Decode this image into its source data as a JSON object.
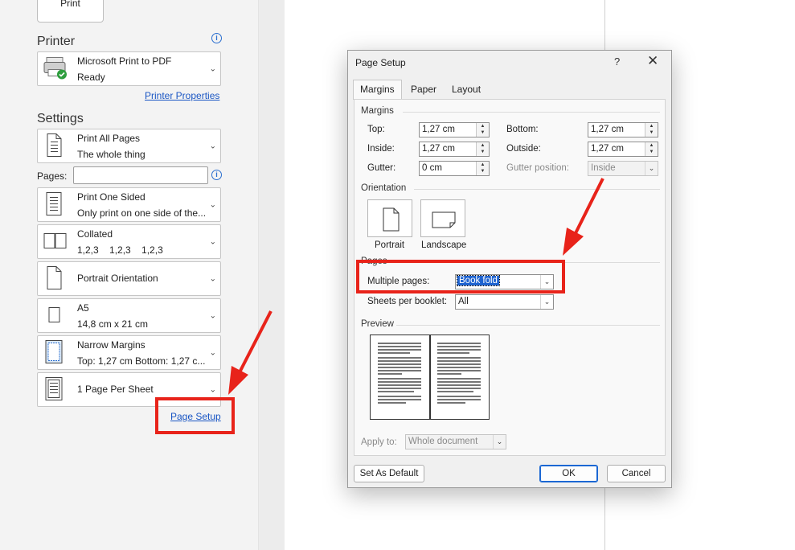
{
  "print_button": {
    "label": "Print"
  },
  "printer": {
    "section_title": "Printer",
    "name": "Microsoft Print to PDF",
    "status": "Ready",
    "properties_link": "Printer Properties"
  },
  "settings": {
    "section_title": "Settings",
    "pages_label": "Pages:",
    "pages_value": "",
    "items": [
      {
        "line1": "Print All Pages",
        "line2": "The whole thing",
        "icon": "pages-icon"
      },
      {
        "line1": "Print One Sided",
        "line2": "Only print on one side of the...",
        "icon": "one-sided-icon"
      },
      {
        "line1": "Collated",
        "line2": "1,2,3    1,2,3    1,2,3",
        "icon": "collated-icon"
      },
      {
        "line1": "Portrait Orientation",
        "line2": "",
        "icon": "portrait-icon"
      },
      {
        "line1": "A5",
        "line2": "14,8 cm x 21 cm",
        "icon": "paper-size-icon"
      },
      {
        "line1": "Narrow Margins",
        "line2": "Top: 1,27 cm Bottom: 1,27 c...",
        "icon": "margins-icon"
      },
      {
        "line1": "1 Page Per Sheet",
        "line2": "",
        "icon": "pages-per-sheet-icon"
      }
    ],
    "page_setup_link": "Page Setup"
  },
  "dialog": {
    "title": "Page Setup",
    "help": "?",
    "close": "✕",
    "tabs": [
      "Margins",
      "Paper",
      "Layout"
    ],
    "active_tab": "Margins",
    "margins_group": "Margins",
    "fields": {
      "top": {
        "label": "Top:",
        "value": "1,27 cm"
      },
      "bottom": {
        "label": "Bottom:",
        "value": "1,27 cm"
      },
      "inside": {
        "label": "Inside:",
        "value": "1,27 cm"
      },
      "outside": {
        "label": "Outside:",
        "value": "1,27 cm"
      },
      "gutter": {
        "label": "Gutter:",
        "value": "0 cm"
      },
      "gutter_position": {
        "label": "Gutter position:",
        "value": "Inside"
      }
    },
    "orientation_group": "Orientation",
    "portrait": "Portrait",
    "landscape": "Landscape",
    "pages_group": "Pages",
    "multiple_pages": {
      "label": "Multiple pages:",
      "value": "Book fold"
    },
    "sheets_per_booklet": {
      "label": "Sheets per booklet:",
      "value": "All"
    },
    "preview_group": "Preview",
    "apply_to": {
      "label": "Apply to:",
      "value": "Whole document"
    },
    "set_default": "Set As Default",
    "ok": "OK",
    "cancel": "Cancel"
  },
  "colors": {
    "annotation_red": "#e8231a",
    "link_blue": "#1a56c4",
    "accent": "#1b67d3"
  }
}
